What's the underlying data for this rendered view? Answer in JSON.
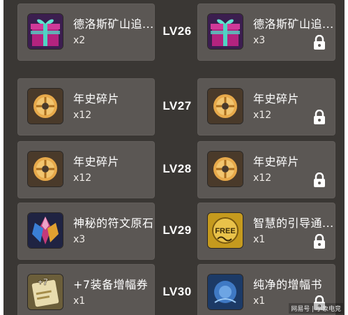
{
  "rows": [
    {
      "level": "LV26",
      "left": {
        "icon": "gift-box-icon",
        "name": "德洛斯矿山追...",
        "qty": "x2",
        "locked": false
      },
      "right": {
        "icon": "gift-box-icon",
        "name": "德洛斯矿山追...",
        "qty": "x3",
        "locked": true
      }
    },
    {
      "level": "LV27",
      "left": {
        "icon": "coin-fragment-icon",
        "name": "年史碎片",
        "qty": "x12",
        "locked": false
      },
      "right": {
        "icon": "coin-fragment-icon",
        "name": "年史碎片",
        "qty": "x12",
        "locked": true
      }
    },
    {
      "level": "LV28",
      "left": {
        "icon": "coin-fragment-icon",
        "name": "年史碎片",
        "qty": "x12",
        "locked": false
      },
      "right": {
        "icon": "coin-fragment-icon",
        "name": "年史碎片",
        "qty": "x12",
        "locked": true
      }
    },
    {
      "level": "LV29",
      "left": {
        "icon": "rune-crystal-icon",
        "name": "神秘的符文原石",
        "qty": "x3",
        "locked": false
      },
      "right": {
        "icon": "free-pass-icon",
        "name": "智慧的引导通...",
        "qty": "x1",
        "locked": true,
        "icon_text": "FREE"
      }
    },
    {
      "level": "LV30",
      "left": {
        "icon": "upgrade-scroll-icon",
        "name": "+7装备增幅券",
        "qty": "x1",
        "locked": false,
        "icon_text": "+7"
      },
      "right": {
        "icon": "pure-book-icon",
        "name": "纯净的增幅书",
        "qty": "x1",
        "locked": true
      }
    }
  ],
  "watermark": "网易号 | 小象电竞",
  "colors": {
    "panel": "#3a3734",
    "card": "#5b5754",
    "text": "#ffffff"
  }
}
